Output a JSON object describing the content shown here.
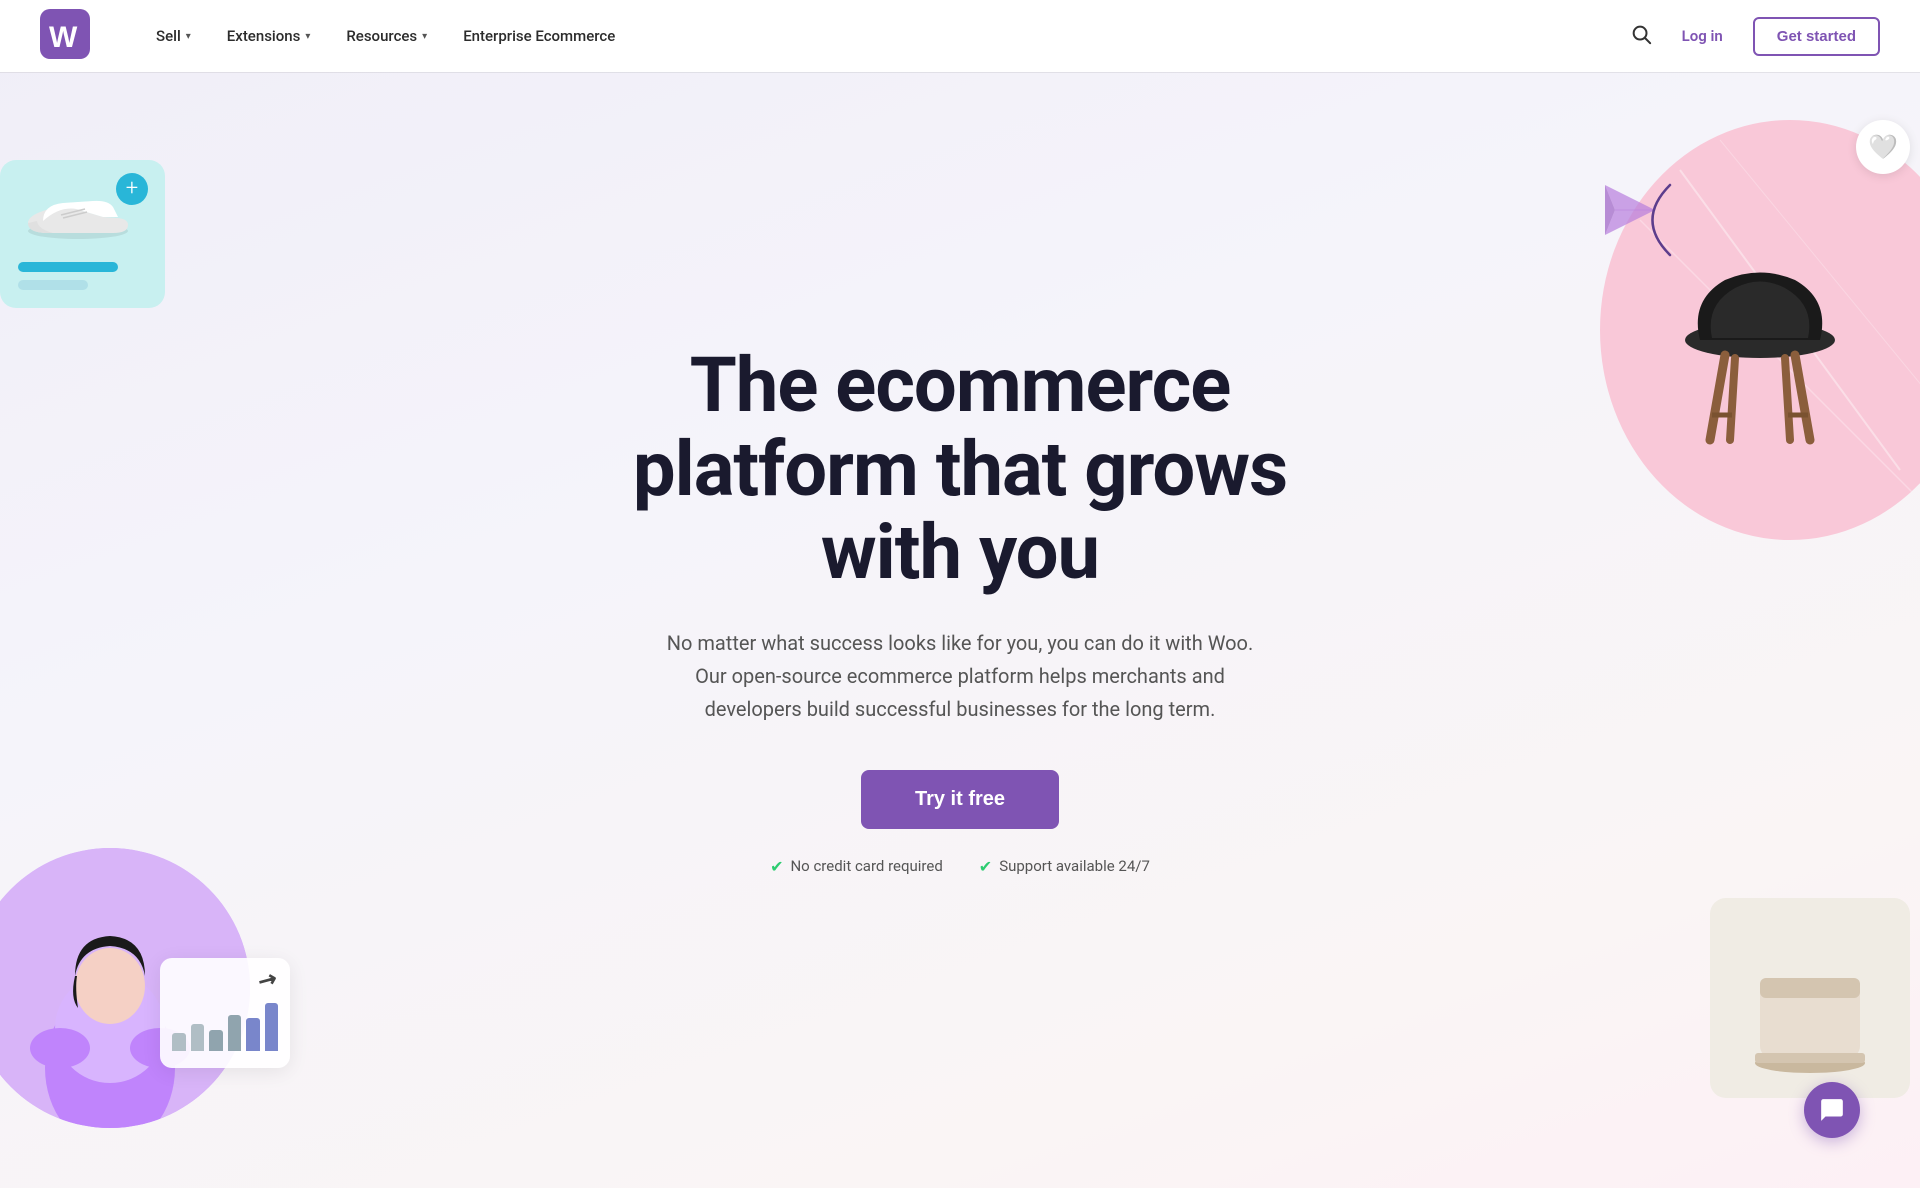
{
  "nav": {
    "logo_alt": "WooCommerce",
    "links": [
      {
        "label": "Sell",
        "has_dropdown": true
      },
      {
        "label": "Extensions",
        "has_dropdown": true
      },
      {
        "label": "Resources",
        "has_dropdown": true
      },
      {
        "label": "Enterprise Ecommerce",
        "has_dropdown": false
      }
    ],
    "login_label": "Log in",
    "cta_label": "Get started",
    "search_icon": "🔍"
  },
  "hero": {
    "title_line1": "The ecommerce",
    "title_line2": "platform that grows",
    "title_line3": "with you",
    "subtitle": "No matter what success looks like for you, you can do it with Woo. Our open-source ecommerce platform helps merchants and developers build successful businesses for the long term.",
    "cta_label": "Try it free",
    "badge1": "No credit card required",
    "badge2": "Support available 24/7"
  },
  "deco": {
    "chart_bars": [
      30,
      45,
      35,
      55,
      50,
      70
    ],
    "bar_colors": [
      "#b0bec5",
      "#b0bec5",
      "#90a4ae",
      "#90a4ae",
      "#7986cb",
      "#7986cb"
    ],
    "add_plus": "+",
    "heart_emoji": "🤍",
    "chat_icon": "💬",
    "arrow_up": "↗"
  },
  "colors": {
    "purple": "#7f54b3",
    "teal": "#29b6d8",
    "pink": "#f9c8d8",
    "cyan_bg": "#c8f0f0",
    "green_check": "#2ecc71"
  }
}
